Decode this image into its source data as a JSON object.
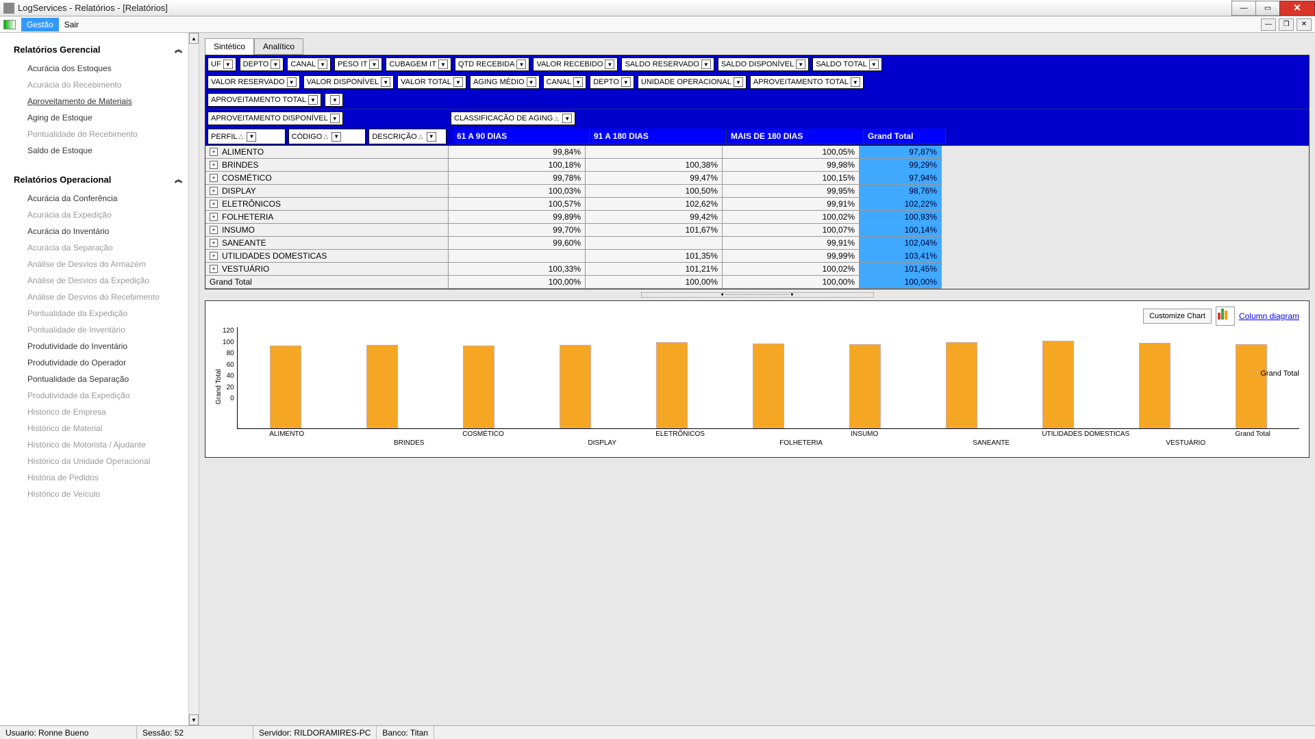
{
  "window": {
    "title": "LogServices - Relatórios - [Relatórios]"
  },
  "menubar": {
    "items": [
      "Gestão",
      "Sair"
    ],
    "active_index": 0
  },
  "sidebar": {
    "panel1": {
      "title": "Relatórios Gerencial",
      "items": [
        {
          "label": "Acurácia dos Estoques",
          "dim": false
        },
        {
          "label": "Acurácia do Recebimento",
          "dim": true
        },
        {
          "label": "Aproveitamento de Materiais",
          "dim": false,
          "selected": true
        },
        {
          "label": "Aging de Estoque",
          "dim": false
        },
        {
          "label": "Pontualidade do Recebimento",
          "dim": true
        },
        {
          "label": "Saldo de Estoque",
          "dim": false
        }
      ]
    },
    "panel2": {
      "title": "Relatórios Operacional",
      "items": [
        {
          "label": "Acurácia da Conferência",
          "dim": false
        },
        {
          "label": "Acurácia da Expedição",
          "dim": true
        },
        {
          "label": "Acurácia do Inventário",
          "dim": false
        },
        {
          "label": "Acurácia da Separação",
          "dim": true
        },
        {
          "label": "Análise de Desvios do Armazém",
          "dim": true
        },
        {
          "label": "Análise de Desvios da Expedição",
          "dim": true
        },
        {
          "label": "Análise de Desvios do Recebimento",
          "dim": true
        },
        {
          "label": "Pontualidade da Expedição",
          "dim": true
        },
        {
          "label": "Pontualidade de Inventário",
          "dim": true
        },
        {
          "label": "Produtividade do Inventário",
          "dim": false
        },
        {
          "label": "Produtividade do Operador",
          "dim": false
        },
        {
          "label": "Pontualidade da Separação",
          "dim": false
        },
        {
          "label": "Produtividade da Expedição",
          "dim": true
        },
        {
          "label": "Historico de Empresa",
          "dim": true
        },
        {
          "label": "Histórico de Material",
          "dim": true
        },
        {
          "label": "Histórico de Motorista / Ajudante",
          "dim": true
        },
        {
          "label": "Histórico da Unidade Operacional",
          "dim": true
        },
        {
          "label": "História de Pedidos",
          "dim": true
        },
        {
          "label": "Histórico de Veículo",
          "dim": true
        }
      ]
    }
  },
  "tabs": {
    "items": [
      "Sintético",
      "Analítico"
    ],
    "active": 0
  },
  "pivot": {
    "filters_row1": [
      "UF",
      "DEPTO",
      "CANAL",
      "PESO IT",
      "CUBAGEM IT",
      "QTD RECEBIDA",
      "VALOR RECEBIDO",
      "SALDO RESERVADO",
      "SALDO DISPONÍVEL",
      "SALDO TOTAL"
    ],
    "filters_row2": [
      "VALOR RESERVADO",
      "VALOR DISPONÍVEL",
      "VALOR TOTAL",
      "AGING MÉDIO",
      "CANAL",
      "DEPTO",
      "UNIDADE OPERACIONAL",
      "APROVEITAMENTO TOTAL"
    ],
    "filters_row3": [
      "APROVEITAMENTO TOTAL"
    ],
    "data_field": "APROVEITAMENTO DISPONÍVEL",
    "col_field": "CLASSIFICAÇÃO DE AGING",
    "row_fields": [
      "PERFIL",
      "CÓDIGO",
      "DESCRIÇÃO"
    ],
    "col_headers": [
      "61 A 90 DIAS",
      "91 A 180 DIAS",
      "MAIS DE 180 DIAS",
      "Grand Total"
    ],
    "rows": [
      {
        "label": "ALIMENTO",
        "v": [
          "99,84%",
          "",
          "100,05%",
          "97,87%"
        ]
      },
      {
        "label": "BRINDES",
        "v": [
          "100,18%",
          "100,38%",
          "99,98%",
          "99,29%"
        ]
      },
      {
        "label": "COSMÉTICO",
        "v": [
          "99,78%",
          "99,47%",
          "100,15%",
          "97,94%"
        ]
      },
      {
        "label": "DISPLAY",
        "v": [
          "100,03%",
          "100,50%",
          "99,95%",
          "98,76%"
        ]
      },
      {
        "label": "ELETRÔNICOS",
        "v": [
          "100,57%",
          "102,62%",
          "99,91%",
          "102,22%"
        ]
      },
      {
        "label": "FOLHETERIA",
        "v": [
          "99,89%",
          "99,42%",
          "100,02%",
          "100,93%"
        ]
      },
      {
        "label": "INSUMO",
        "v": [
          "99,70%",
          "101,67%",
          "100,07%",
          "100,14%"
        ]
      },
      {
        "label": "SANEANTE",
        "v": [
          "99,60%",
          "",
          "99,91%",
          "102,04%"
        ]
      },
      {
        "label": "UTILIDADES DOMESTICAS",
        "v": [
          "",
          "101,35%",
          "99,99%",
          "103,41%"
        ]
      },
      {
        "label": "VESTUÁRIO",
        "v": [
          "100,33%",
          "101,21%",
          "100,02%",
          "101,45%"
        ]
      }
    ],
    "grand_total_row": {
      "label": "Grand Total",
      "v": [
        "100,00%",
        "100,00%",
        "100,00%",
        "100,00%"
      ]
    }
  },
  "chart_toolbar": {
    "customize": "Customize Chart",
    "link": "Column diagram"
  },
  "chart_data": {
    "type": "bar",
    "ylabel": "Grand Total",
    "ylim": [
      0,
      120
    ],
    "yticks": [
      120,
      100,
      80,
      60,
      40,
      20,
      0
    ],
    "legend": "Grand Total",
    "categories": [
      "ALIMENTO",
      "BRINDES",
      "COSMÉTICO",
      "DISPLAY",
      "ELETRÔNICOS",
      "FOLHETERIA",
      "INSUMO",
      "SANEANTE",
      "UTILIDADES DOMESTICAS",
      "VESTUÁRIO",
      "Grand Total"
    ],
    "values": [
      97.87,
      99.29,
      97.94,
      98.76,
      102.22,
      100.93,
      100.14,
      102.04,
      103.41,
      101.45,
      100.0
    ]
  },
  "statusbar": {
    "user": "Usuario: Ronne Bueno",
    "session": "Sessão: 52",
    "server": "Servidor: RILDORAMIRES-PC",
    "db": "Banco: Titan"
  }
}
